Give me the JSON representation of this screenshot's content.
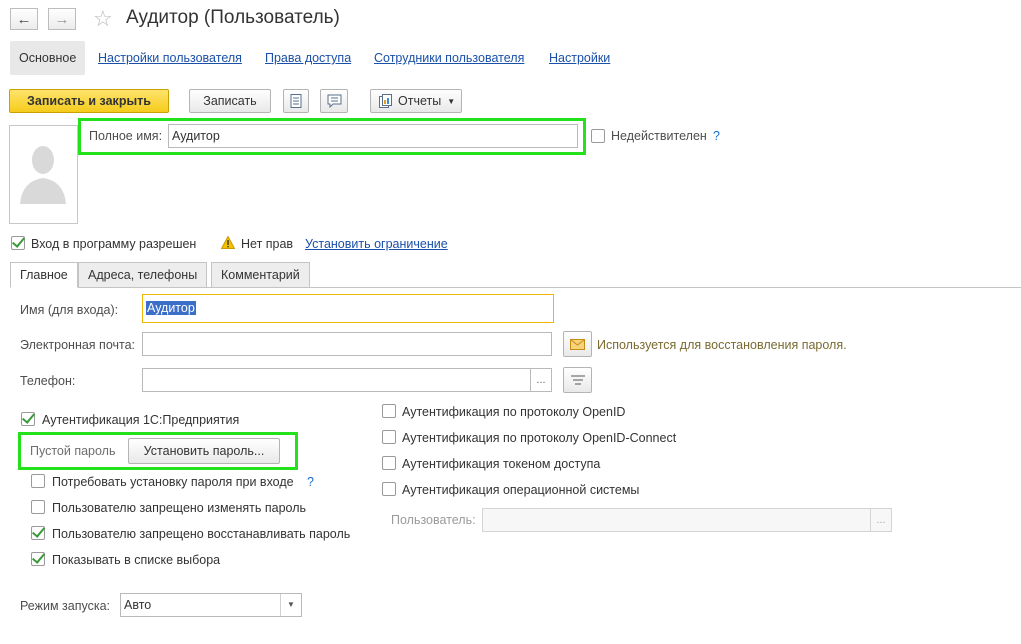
{
  "header": {
    "title": "Аудитор (Пользователь)"
  },
  "sections": {
    "main": "Основное",
    "user_settings": "Настройки пользователя",
    "access_rights": "Права доступа",
    "user_employees": "Сотрудники пользователя",
    "settings": "Настройки"
  },
  "toolbar": {
    "save_close": "Записать и закрыть",
    "save": "Записать",
    "reports": "Отчеты"
  },
  "form": {
    "full_name_label": "Полное имя:",
    "full_name_value": "Аудитор",
    "invalid_label": "Недействителен",
    "help": "?",
    "login_allowed_label": "Вход в программу разрешен",
    "no_rights": "Нет прав",
    "set_restriction": "Установить ограничение"
  },
  "tabs": {
    "main": "Главное",
    "addresses": "Адреса, телефоны",
    "comment": "Комментарий"
  },
  "main_tab": {
    "login_name_label": "Имя (для входа):",
    "login_name_value": "Аудитор",
    "email_label": "Электронная почта:",
    "email_value": "",
    "email_hint": "Используется для восстановления пароля.",
    "phone_label": "Телефон:",
    "phone_value": "",
    "dots": "...",
    "auth_1c": "Аутентификация 1С:Предприятия",
    "empty_password": "Пустой пароль",
    "set_password": "Установить пароль...",
    "require_password": "Потребовать установку пароля при входе",
    "forbid_change": "Пользователю запрещено изменять пароль",
    "forbid_restore": "Пользователю запрещено восстанавливать пароль",
    "show_in_list": "Показывать в списке выбора",
    "auth_openid": "Аутентификация по протоколу OpenID",
    "auth_openid_connect": "Аутентификация по протоколу OpenID-Connect",
    "auth_token": "Аутентификация токеном доступа",
    "auth_os": "Аутентификация операционной системы",
    "os_user_label": "Пользователь:",
    "os_user_value": "",
    "launch_mode_label": "Режим запуска:",
    "launch_mode_value": "Авто"
  },
  "colors": {
    "primary": "#f5cc1c",
    "link": "#1a50a8",
    "highlight": "#23e11d",
    "focus": "#f0b800"
  }
}
